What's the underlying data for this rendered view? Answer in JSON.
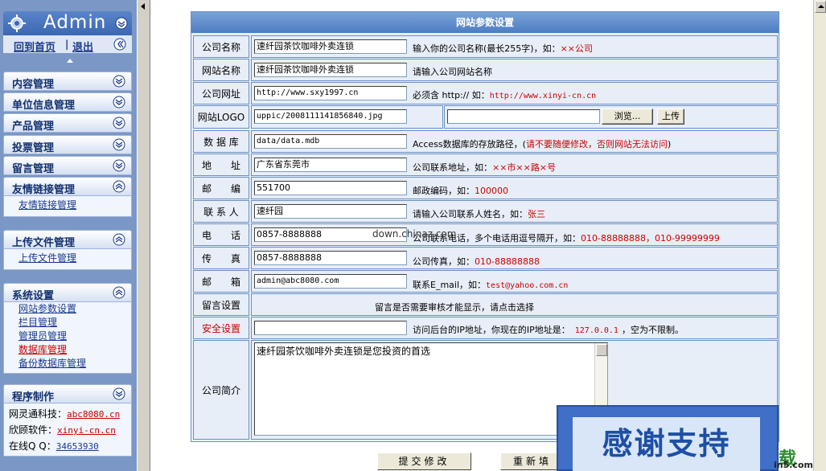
{
  "sidebar": {
    "logo_text": "Admin",
    "nav": {
      "home": "回到首页",
      "separator": "|",
      "logout": "退出"
    },
    "menus": [
      {
        "label": "内容管理"
      },
      {
        "label": "单位信息管理"
      },
      {
        "label": "产品管理"
      },
      {
        "label": "投票管理"
      },
      {
        "label": "留言管理"
      },
      {
        "label": "友情链接管理",
        "items": [
          "友情链接管理"
        ]
      },
      {
        "label": "上传文件管理",
        "items": [
          "上传文件管理"
        ]
      },
      {
        "label": "系统设置",
        "items": [
          "网站参数设置",
          "栏目管理",
          "管理员管理",
          "数据库管理",
          "备份数据库管理"
        ]
      },
      {
        "label": "程序制作"
      }
    ],
    "credits": [
      {
        "label": "网灵通科技：",
        "value": "abc8080.cn"
      },
      {
        "label": "欣顾软件：",
        "value": "xinyi-cn.cn"
      },
      {
        "label": "在线Q Q：",
        "value": "34653930"
      }
    ]
  },
  "form": {
    "title": "网站参数设置",
    "rows": [
      {
        "label": "公司名称",
        "value": "速纤园茶饮咖啡外卖连锁",
        "hint": "输入你的公司名称(最长255字)，如：",
        "example": "××公司"
      },
      {
        "label": "网站名称",
        "value": "速纤园茶饮咖啡外卖连锁",
        "hint": "请输入公司网站名称"
      },
      {
        "label": "公司网址",
        "value": "http://www.sxy1997.cn",
        "hint": "必须含 http:// 如：",
        "example": "http://www.xinyi-cn.cn"
      },
      {
        "label": "网站LOGO",
        "value": "uppic/2008111141856840.jpg",
        "browse": "浏览...",
        "upload": "上传"
      },
      {
        "label": "数 据 库",
        "value": "data/data.mdb",
        "hint": "Access数据库的存放路径，(",
        "example": "请不要随便修改，否则网站无法访问",
        "hint_end": ")"
      },
      {
        "label": "地　　址",
        "value": "广东省东莞市",
        "hint": "公司联系地址，如：",
        "example": "××市××路×号"
      },
      {
        "label": "邮　　编",
        "value": "551700",
        "hint": "邮政编码，如：",
        "example": "100000"
      },
      {
        "label": "联 系 人",
        "value": "速纤园",
        "hint": "请输入公司联系人姓名，如：",
        "example": "张三"
      },
      {
        "label": "电　　话",
        "value": "0857-8888888",
        "hint": "公司联系电话，多个电话用逗号隔开，如：",
        "example": "010-88888888，010-99999999"
      },
      {
        "label": "传　　真",
        "value": "0857-8888888",
        "hint": "公司传真，如：",
        "example": "010-88888888"
      },
      {
        "label": "邮　　箱",
        "value": "admin@abc8080.com",
        "hint": "联系E_mail，如：",
        "example": "test@yahoo.com.cn"
      },
      {
        "label": "留言设置",
        "hint": "留言是否需要审核才能显示，请点击选择"
      },
      {
        "label": "安全设置",
        "value": "",
        "hint": "访问后台的IP地址，你现在的IP地址是：",
        "example": "127.0.0.1",
        "hint_end": "，空为不限制。"
      },
      {
        "label": "公司简介",
        "value": "速纤园茶饮咖啡外卖连锁是您投资的首选"
      }
    ],
    "submit": "提交修改",
    "reset": "重新填"
  },
  "overlay": {
    "watermark": "down.chinaz.com",
    "thanks": "感谢支持",
    "corner": "载",
    "corner2": "in5.com"
  },
  "colors": {
    "accent": "#4c7cc2",
    "example_red": "#cc0000",
    "link_blue": "#1a3a8c"
  }
}
